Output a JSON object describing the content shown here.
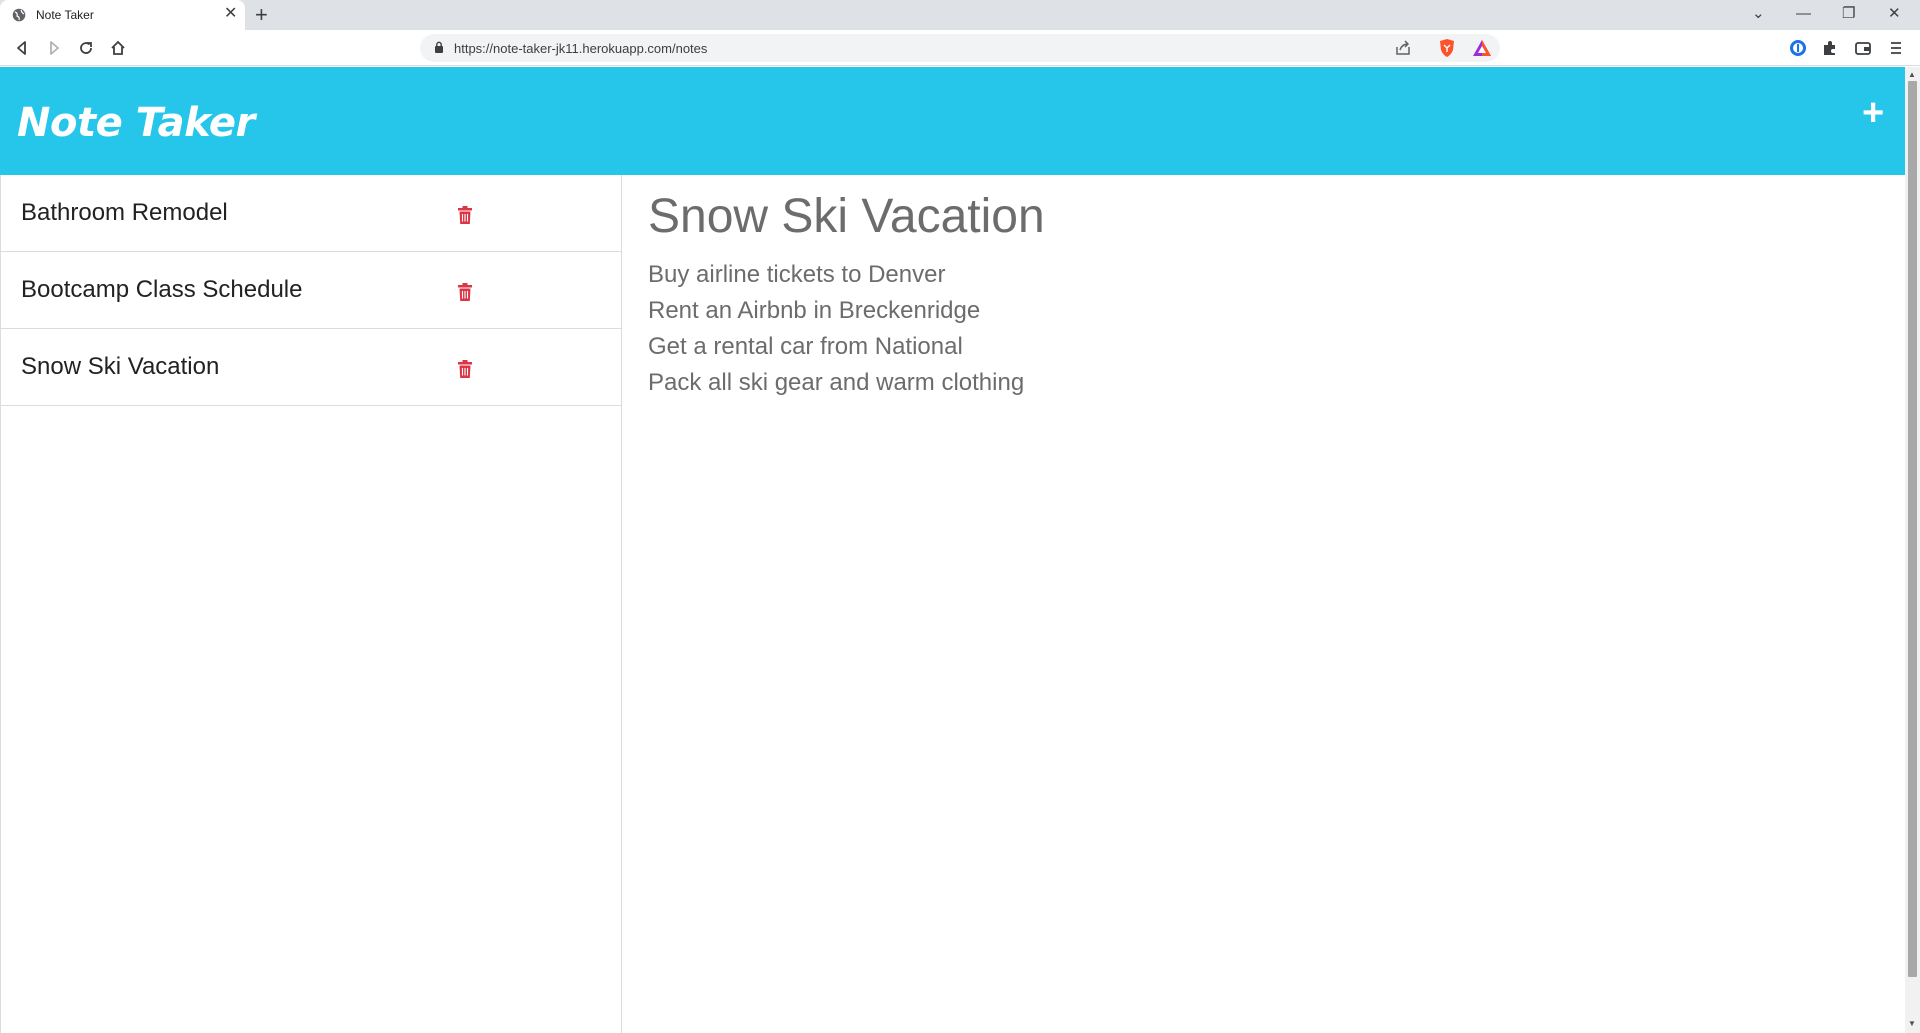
{
  "browser": {
    "tab_title": "Note Taker",
    "tab_close": "✕",
    "new_tab": "+",
    "url": "https://note-taker-jk11.herokuapp.com/notes",
    "window_controls": {
      "tab_search": "⌄",
      "minimize": "—",
      "restore": "❐",
      "close": "✕"
    }
  },
  "app": {
    "title": "Note Taker",
    "new_note_icon": "+"
  },
  "notes": [
    {
      "title": "Bathroom Remodel"
    },
    {
      "title": "Bootcamp Class Schedule"
    },
    {
      "title": "Snow Ski Vacation"
    }
  ],
  "active_note": {
    "title": "Snow Ski Vacation",
    "lines": [
      "Buy airline tickets to Denver",
      "Rent an Airbnb in Breckenridge",
      "Get a rental car from National",
      "Pack all ski gear and warm clothing"
    ]
  },
  "colors": {
    "header": "#26c6ea",
    "trash": "#dc3545",
    "note_text": "#6c6c6c"
  }
}
